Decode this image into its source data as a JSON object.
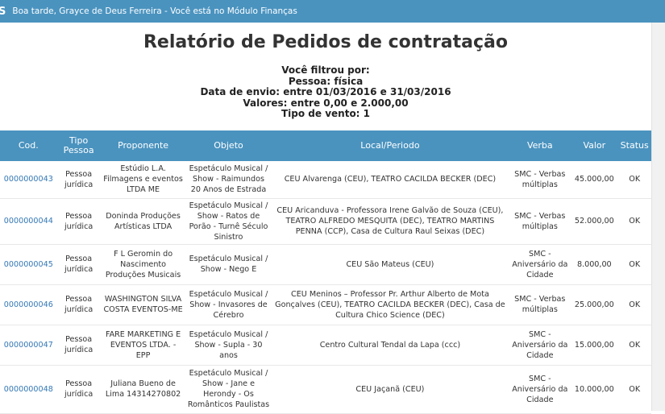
{
  "header": {
    "logo": "S",
    "greeting": "Boa tarde, Grayce de Deus Ferreira - Você está no Módulo Finanças"
  },
  "page": {
    "title": "Relatório de Pedidos de contratação",
    "filters": [
      "Você filtrou por:",
      "Pessoa: física",
      "Data de envio: entre 01/03/2016 e 31/03/2016",
      "Valores: entre 0,00 e 2.000,00",
      "Tipo de vento: 1"
    ]
  },
  "table": {
    "columns": [
      "Cod.",
      "Tipo Pessoa",
      "Proponente",
      "Objeto",
      "Local/Periodo",
      "Verba",
      "Valor",
      "Status"
    ],
    "rows": [
      {
        "cod": "0000000043",
        "tipo": "Pessoa jurídica",
        "proponente": "Estúdio L.A. Filmagens e eventos LTDA ME",
        "objeto": "Espetáculo Musical / Show - Raimundos 20 Anos de Estrada",
        "local": "CEU Alvarenga (CEU), TEATRO CACILDA BECKER (DEC)",
        "verba": "SMC - Verbas múltiplas",
        "valor": "45.000,00",
        "status": "OK"
      },
      {
        "cod": "0000000044",
        "tipo": "Pessoa jurídica",
        "proponente": "Doninda Produções Artísticas LTDA",
        "objeto": "Espetáculo Musical / Show - Ratos de Porão - Turnê Século Sinistro",
        "local": "CEU Aricanduva - Professora Irene Galvão de Souza (CEU), TEATRO ALFREDO MESQUITA (DEC), TEATRO MARTINS PENNA (CCP), Casa de Cultura Raul Seixas (DEC)",
        "verba": "SMC - Verbas múltiplas",
        "valor": "52.000,00",
        "status": "OK"
      },
      {
        "cod": "0000000045",
        "tipo": "Pessoa jurídica",
        "proponente": "F L Geromin do Nascimento Produções Musicais",
        "objeto": "Espetáculo Musical / Show - Nego E",
        "local": "CEU São Mateus (CEU)",
        "verba": "SMC - Aniversário da Cidade",
        "valor": "8.000,00",
        "status": "OK"
      },
      {
        "cod": "0000000046",
        "tipo": "Pessoa jurídica",
        "proponente": "WASHINGTON SILVA COSTA EVENTOS-ME",
        "objeto": "Espetáculo Musical / Show - Invasores de Cérebro",
        "local": "CEU Meninos – Professor Pr. Arthur Alberto de Mota Gonçalves (CEU), TEATRO CACILDA BECKER (DEC), Casa de Cultura Chico Science (DEC)",
        "verba": "SMC - Verbas múltiplas",
        "valor": "25.000,00",
        "status": "OK"
      },
      {
        "cod": "0000000047",
        "tipo": "Pessoa jurídica",
        "proponente": "FARE MARKETING E EVENTOS LTDA. - EPP",
        "objeto": "Espetáculo Musical / Show - Supla - 30 anos",
        "local": "Centro Cultural Tendal da Lapa (ccc)",
        "verba": "SMC - Aniversário da Cidade",
        "valor": "15.000,00",
        "status": "OK"
      },
      {
        "cod": "0000000048",
        "tipo": "Pessoa jurídica",
        "proponente": "Juliana Bueno de Lima 14314270802",
        "objeto": "Espetáculo Musical / Show - Jane e Herondy - Os Românticos Paulistas",
        "local": "CEU Jaçanã (CEU)",
        "verba": "SMC - Aniversário da Cidade",
        "valor": "10.000,00",
        "status": "OK"
      }
    ]
  }
}
